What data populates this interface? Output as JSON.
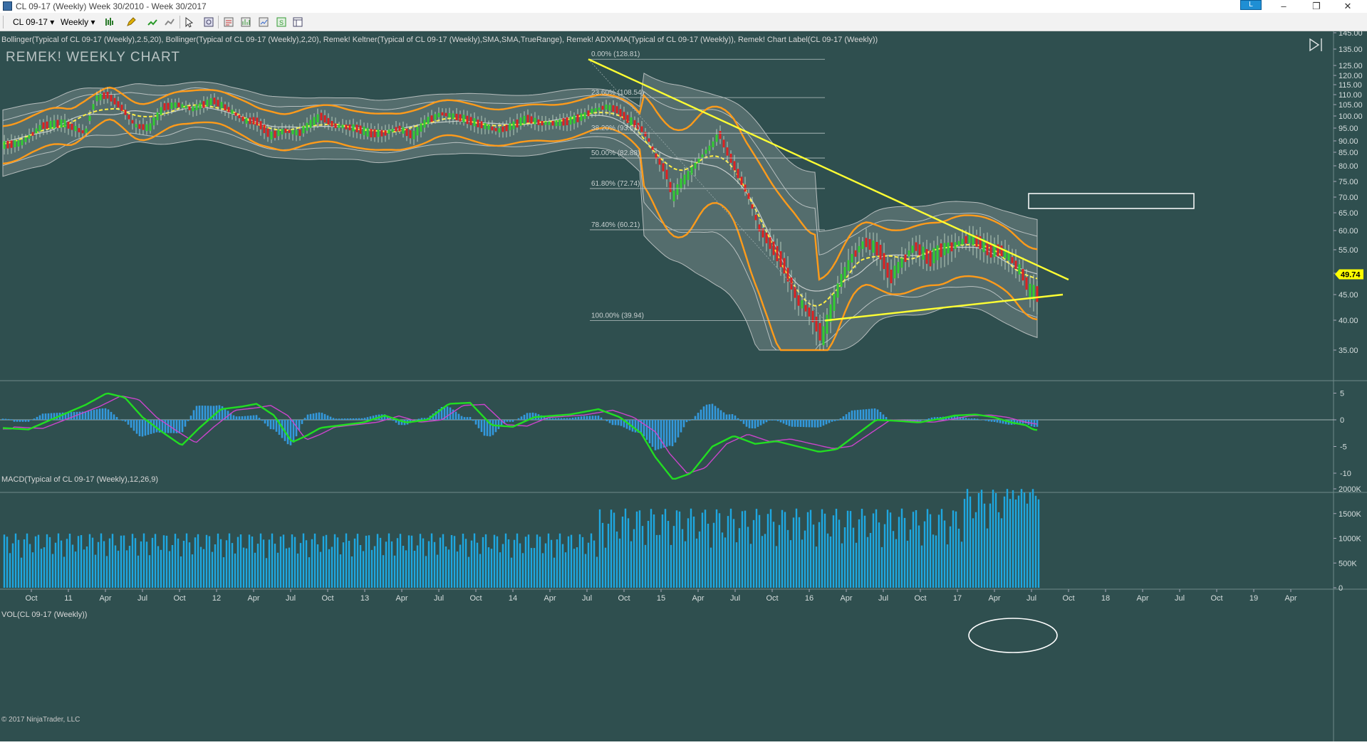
{
  "window": {
    "title": "CL 09-17 (Weekly)  Week 30/2010 - Week 30/2017",
    "badge": "L",
    "min": "–",
    "restore": "❐",
    "close": "✕"
  },
  "toolbar": {
    "instrument": "CL 09-17 ▾",
    "period": "Weekly ▾",
    "icons": [
      "bars-icon",
      "pencil-icon",
      "add-indicator-icon",
      "strategy-icon",
      "pointer-icon",
      "zoom-icon",
      "templates-icon",
      "chart-trader-icon",
      "data-box-icon",
      "properties-icon",
      "layout-icon"
    ]
  },
  "price_panel": {
    "indicator_label": "Bollinger(Typical of CL 09-17 (Weekly),2.5,20), Bollinger(Typical of CL 09-17 (Weekly),2,20), Remek! Keltner(Typical of CL 09-17 (Weekly),SMA,SMA,TrueRange), Remek! ADXVMA(Typical of CL 09-17 (Weekly)), Remek! Chart Label(CL 09-17 (Weekly))",
    "watermark": "REMEK! WEEKLY CHART",
    "last_price": "49.74",
    "y_ticks": [
      "145.00",
      "135.00",
      "125.00",
      "120.00",
      "115.00",
      "110.00",
      "105.00",
      "100.00",
      "95.00",
      "90.00",
      "85.00",
      "80.00",
      "75.00",
      "70.00",
      "65.00",
      "60.00",
      "55.00",
      "50.00",
      "45.00",
      "40.00",
      "35.00"
    ],
    "fib_levels": [
      {
        "label": "0.00% (128.81)",
        "value": 128.81
      },
      {
        "label": "23.60% (108.54)",
        "value": 108.54
      },
      {
        "label": "38.20% (93.01)",
        "value": 93.01
      },
      {
        "label": "50.00% (82.88)",
        "value": 82.88
      },
      {
        "label": "61.80% (72.74)",
        "value": 72.74
      },
      {
        "label": "78.40% (60.21)",
        "value": 60.21
      },
      {
        "label": "100.00% (39.94)",
        "value": 39.94
      }
    ]
  },
  "macd_panel": {
    "indicator_label": "MACD(Typical of CL 09-17 (Weekly),12,26,9)",
    "y_ticks": [
      "5",
      "0",
      "-5",
      "-10"
    ]
  },
  "volume_panel": {
    "indicator_label": "VOL(CL 09-17 (Weekly))",
    "y_ticks": [
      "2000K",
      "1500K",
      "1000K",
      "500K",
      "0"
    ],
    "copyright": "© 2017 NinjaTrader, LLC"
  },
  "time_axis": {
    "ticks": [
      "Oct",
      "11",
      "Apr",
      "Jul",
      "Oct",
      "12",
      "Apr",
      "Jul",
      "Oct",
      "13",
      "Apr",
      "Jul",
      "Oct",
      "14",
      "Apr",
      "Jul",
      "Oct",
      "15",
      "Apr",
      "Jul",
      "Oct",
      "16",
      "Apr",
      "Jul",
      "Oct",
      "17",
      "Apr",
      "Jul",
      "Oct",
      "18",
      "Apr",
      "Jul",
      "Oct",
      "19",
      "Apr"
    ]
  },
  "colors": {
    "background": "#2f4f4f",
    "orange_band": "#ff9b1a",
    "yellow_trend": "#ffff33",
    "macd_line": "#22dd22",
    "signal_line": "#cc44cc",
    "histogram": "#3399dd",
    "volume": "#1ea7e0",
    "up_candle": "#33cc33",
    "down_candle": "#dd2222"
  }
}
